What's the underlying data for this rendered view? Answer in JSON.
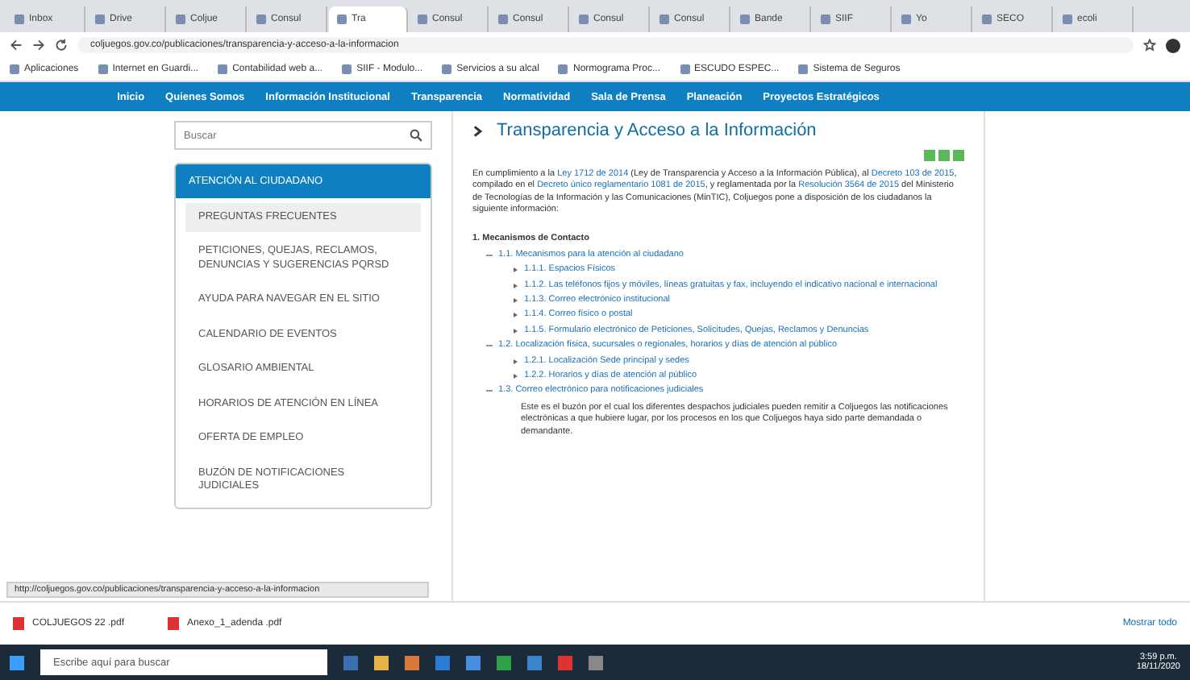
{
  "browser": {
    "tabs": [
      {
        "label": "Inbox",
        "selected": false
      },
      {
        "label": "Drive",
        "selected": false
      },
      {
        "label": "Coljue",
        "selected": false
      },
      {
        "label": "Consul",
        "selected": false
      },
      {
        "label": "Tra",
        "selected": true
      },
      {
        "label": "Consul",
        "selected": false
      },
      {
        "label": "Consul",
        "selected": false
      },
      {
        "label": "Consul",
        "selected": false
      },
      {
        "label": "Consul",
        "selected": false
      },
      {
        "label": "Bande",
        "selected": false
      },
      {
        "label": "SIIF",
        "selected": false
      },
      {
        "label": "Yo",
        "selected": false
      },
      {
        "label": "SECO",
        "selected": false
      },
      {
        "label": "ecoli",
        "selected": false
      }
    ],
    "address": "coljuegos.gov.co/publicaciones/transparencia-y-acceso-a-la-informacion",
    "bookmarks": [
      "Aplicaciones",
      "Internet en Guardi...",
      "Contabilidad web a...",
      "SIIF - Modulo...",
      "Servicios a su alcal",
      "Normograma Proc...",
      "ESCUDO ESPEC...",
      "Sistema de Seguros"
    ]
  },
  "nav": [
    "Inicio",
    "Quienes Somos",
    "Información Institucional",
    "Transparencia",
    "Normatividad",
    "Sala de Prensa",
    "Planeación",
    "Proyectos Estratégicos"
  ],
  "search": {
    "placeholder": "Buscar"
  },
  "sidebar": {
    "title": "ATENCIÓN AL CIUDADANO",
    "items": [
      {
        "label": "PREGUNTAS FRECUENTES",
        "selected": true
      },
      {
        "label": "PETICIONES, QUEJAS, RECLAMOS, DENUNCIAS Y SUGERENCIAS PQRSD",
        "selected": false
      },
      {
        "label": "AYUDA PARA NAVEGAR EN EL SITIO",
        "selected": false
      },
      {
        "label": "CALENDARIO DE EVENTOS",
        "selected": false
      },
      {
        "label": "GLOSARIO AMBIENTAL",
        "selected": false
      },
      {
        "label": "HORARIOS DE ATENCIÓN EN LÍNEA",
        "selected": false
      },
      {
        "label": "OFERTA DE EMPLEO",
        "selected": false
      },
      {
        "label": "BUZÓN DE NOTIFICACIONES JUDICIALES",
        "selected": false
      }
    ]
  },
  "main": {
    "title": "Transparencia y Acceso a la Información",
    "intro": [
      "En cumplimiento a la ",
      "Ley 1712 de 2014",
      " (Ley de Transparencia y Acceso a la Información Pública), al ",
      "Decreto 103 de 2015",
      ", compilado en el ",
      "Decreto único reglamentario 1081 de 2015",
      ", y reglamentada por la ",
      "Resolución 3564 de 2015",
      " del Ministerio de Tecnologías de la Información y las Comunicaciones (MinTIC), Coljuegos pone a disposición de los ciudadanos la siguiente información:"
    ],
    "section": "1. Mecanismos de Contacto",
    "tree": [
      {
        "label": "1.1. Mecanismos para la atención al ciudadano",
        "children": [
          {
            "label": "1.1.1. Espacios Físicos"
          },
          {
            "label": "1.1.2. Las teléfonos fijos y móviles, líneas gratuitas y fax, incluyendo el indicativo nacional e internacional"
          },
          {
            "label": "1.1.3. Correo electrónico institucional"
          },
          {
            "label": "1.1.4. Correo físico o postal"
          },
          {
            "label": "1.1.5. Formulario electrónico de Peticiones, Solicitudes, Quejas, Reclamos y Denuncias"
          }
        ]
      },
      {
        "label": "1.2. Localización física, sucursales o regionales, horarios y días de atención al público",
        "children": [
          {
            "label": "1.2.1. Localización Sede principal y sedes"
          },
          {
            "label": "1.2.2. Horarios y días de atención al público"
          }
        ]
      },
      {
        "label": "1.3. Correo electrónico para notificaciones judiciales",
        "note": "Este es el buzón por el cual los diferentes despachos judiciales pueden remitir a Coljuegos las notificaciones electrónicas a que hubiere lugar, por los procesos en los que Coljuegos haya sido parte demandada o demandante."
      }
    ]
  },
  "status_url": "http://coljuegos.gov.co/publicaciones/transparencia-y-acceso-a-la-informacion",
  "downloads": {
    "items": [
      "COLJUEGOS 22 .pdf",
      "Anexo_1_adenda .pdf"
    ],
    "show_all": "Mostrar todo"
  },
  "taskbar": {
    "search": "Escribe aquí para buscar",
    "time": "3:59 p.m.",
    "date": "18/11/2020"
  }
}
